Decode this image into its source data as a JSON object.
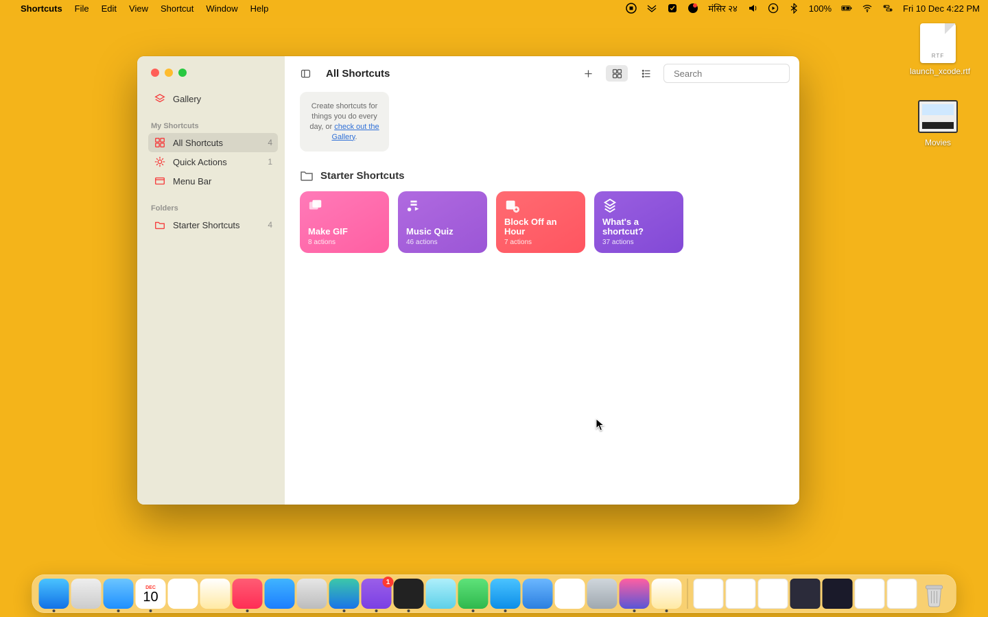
{
  "menubar": {
    "app_name": "Shortcuts",
    "items": [
      "File",
      "Edit",
      "View",
      "Shortcut",
      "Window",
      "Help"
    ],
    "status": {
      "locale_date": "मंसिर २४",
      "battery": "100%",
      "clock": "Fri 10 Dec  4:22 PM"
    }
  },
  "desktop": {
    "file1": {
      "label": "launch_xcode.rtf",
      "badge": "RTF"
    },
    "file2": {
      "label": "Movies"
    }
  },
  "window": {
    "title": "All Shortcuts",
    "search_placeholder": "Search",
    "sidebar": {
      "gallery": "Gallery",
      "section1_header": "My Shortcuts",
      "items1": [
        {
          "label": "All Shortcuts",
          "count": "4",
          "icon": "grid"
        },
        {
          "label": "Quick Actions",
          "count": "1",
          "icon": "gear"
        },
        {
          "label": "Menu Bar",
          "count": "",
          "icon": "menubar"
        }
      ],
      "section2_header": "Folders",
      "items2": [
        {
          "label": "Starter Shortcuts",
          "count": "4"
        }
      ]
    },
    "infobox": {
      "text_a": "Create shortcuts for things you do every day, or ",
      "link": "check out the Gallery",
      "text_b": "."
    },
    "section_title": "Starter Shortcuts",
    "cards": [
      {
        "title": "Make GIF",
        "sub": "8 actions",
        "icon": "gif"
      },
      {
        "title": "Music Quiz",
        "sub": "46 actions",
        "icon": "music"
      },
      {
        "title": "Block Off an Hour",
        "sub": "7 actions",
        "icon": "calendar"
      },
      {
        "title": "What's a shortcut?",
        "sub": "37 actions",
        "icon": "shortcut"
      }
    ]
  },
  "dock": {
    "apps": [
      {
        "name": "finder",
        "bg": "linear-gradient(#4ac3ff,#1271e6)",
        "running": true
      },
      {
        "name": "launchpad",
        "bg": "linear-gradient(#eee,#ccc)"
      },
      {
        "name": "mail",
        "bg": "linear-gradient(#6bc5ff,#1e8fff)",
        "running": true
      },
      {
        "name": "calendar",
        "bg": "#fff",
        "running": true,
        "cal": "10",
        "calmon": "DEC"
      },
      {
        "name": "reminders",
        "bg": "#fff"
      },
      {
        "name": "notes-alt",
        "bg": "linear-gradient(#fff,#ffe9a3)"
      },
      {
        "name": "music",
        "bg": "linear-gradient(#ff5c74,#ff2d55)",
        "running": true
      },
      {
        "name": "appstore",
        "bg": "linear-gradient(#40b4ff,#1c7eff)"
      },
      {
        "name": "settings",
        "bg": "linear-gradient(#e6e6e6,#bcbcbc)"
      },
      {
        "name": "edge",
        "bg": "linear-gradient(#3cc8a9,#1a73e8)",
        "running": true
      },
      {
        "name": "viber",
        "bg": "linear-gradient(#9a5fe8,#7b3fe4)",
        "running": true,
        "badge": "1"
      },
      {
        "name": "terminal",
        "bg": "#222",
        "running": true
      },
      {
        "name": "blocked",
        "bg": "linear-gradient(#aeeffb,#5dd0e8)"
      },
      {
        "name": "whatsapp",
        "bg": "linear-gradient(#5ee27a,#2fb84d)",
        "running": true
      },
      {
        "name": "skype",
        "bg": "linear-gradient(#4ac3ff,#0c8ee8)",
        "running": true
      },
      {
        "name": "xcode",
        "bg": "linear-gradient(#6bb7ff,#2b7fe0)"
      },
      {
        "name": "photos",
        "bg": "#fff"
      },
      {
        "name": "preview",
        "bg": "linear-gradient(#cfd6dc,#9fa8b0)"
      },
      {
        "name": "shortcuts",
        "bg": "linear-gradient(#ff5fa2,#5856d6)",
        "running": true
      },
      {
        "name": "notes",
        "bg": "linear-gradient(#fff,#ffe9a3)",
        "running": true
      }
    ],
    "minis": 7
  }
}
